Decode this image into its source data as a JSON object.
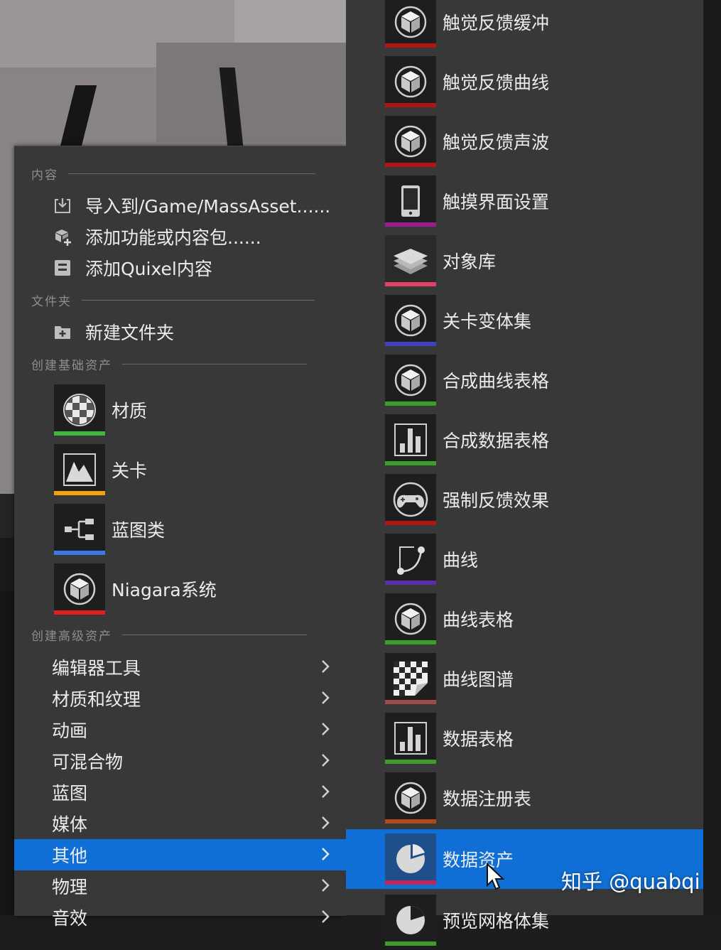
{
  "left_menu": {
    "sections": {
      "content": "内容",
      "folder": "文件夹",
      "basic_assets": "创建基础资产",
      "advanced_assets": "创建高级资产"
    },
    "content_items": [
      {
        "label": "导入到/Game/MassAsset......",
        "icon": "import-icon"
      },
      {
        "label": "添加功能或内容包......",
        "icon": "add-feature-pack-icon"
      },
      {
        "label": "添加Quixel内容",
        "icon": "quixel-icon"
      }
    ],
    "folder_items": [
      {
        "label": "新建文件夹",
        "icon": "new-folder-icon"
      }
    ],
    "basic_assets": [
      {
        "label": "材质",
        "icon": "material-icon",
        "color": "#3db83d"
      },
      {
        "label": "关卡",
        "icon": "level-icon",
        "color": "#f5a10e"
      },
      {
        "label": "蓝图类",
        "icon": "blueprint-icon",
        "color": "#3c78e6"
      },
      {
        "label": "Niagara系统",
        "icon": "cube-icon",
        "color": "#e01e1e"
      }
    ],
    "advanced_categories": [
      {
        "label": "编辑器工具"
      },
      {
        "label": "材质和纹理"
      },
      {
        "label": "动画"
      },
      {
        "label": "可混合物"
      },
      {
        "label": "蓝图"
      },
      {
        "label": "媒体"
      },
      {
        "label": "其他",
        "selected": true
      },
      {
        "label": "物理"
      },
      {
        "label": "音效"
      }
    ]
  },
  "right_menu": {
    "items": [
      {
        "label": "触觉反馈缓冲",
        "icon": "cube-icon",
        "color": "#b01515"
      },
      {
        "label": "触觉反馈曲线",
        "icon": "cube-icon",
        "color": "#b01515"
      },
      {
        "label": "触觉反馈声波",
        "icon": "cube-icon",
        "color": "#b01515"
      },
      {
        "label": "触摸界面设置",
        "icon": "tablet-icon",
        "color": "#9a1e8c"
      },
      {
        "label": "对象库",
        "icon": "stack-icon",
        "color": "#e0406a"
      },
      {
        "label": "关卡变体集",
        "icon": "cube-icon",
        "color": "#4040c0"
      },
      {
        "label": "合成曲线表格",
        "icon": "cube-icon",
        "color": "#3c9c2c"
      },
      {
        "label": "合成数据表格",
        "icon": "bar-chart-icon",
        "color": "#3c9c2c"
      },
      {
        "label": "强制反馈效果",
        "icon": "gamepad-icon",
        "color": "#b01515"
      },
      {
        "label": "曲线",
        "icon": "curve-icon",
        "color": "#5a2ea8"
      },
      {
        "label": "曲线表格",
        "icon": "cube-icon",
        "color": "#3c9c2c"
      },
      {
        "label": "曲线图谱",
        "icon": "checker-page-icon",
        "color": "#a04a4a"
      },
      {
        "label": "数据表格",
        "icon": "bar-chart-icon",
        "color": "#3c9c2c"
      },
      {
        "label": "数据注册表",
        "icon": "cube-icon",
        "color": "#b04a1e"
      },
      {
        "label": "数据资产",
        "icon": "pie-icon",
        "color": "#c0245a",
        "selected": true
      },
      {
        "label": "预览网格体集",
        "icon": "pie-icon",
        "color": "#3c9c2c"
      }
    ]
  },
  "watermark": "知乎 @quabqi"
}
